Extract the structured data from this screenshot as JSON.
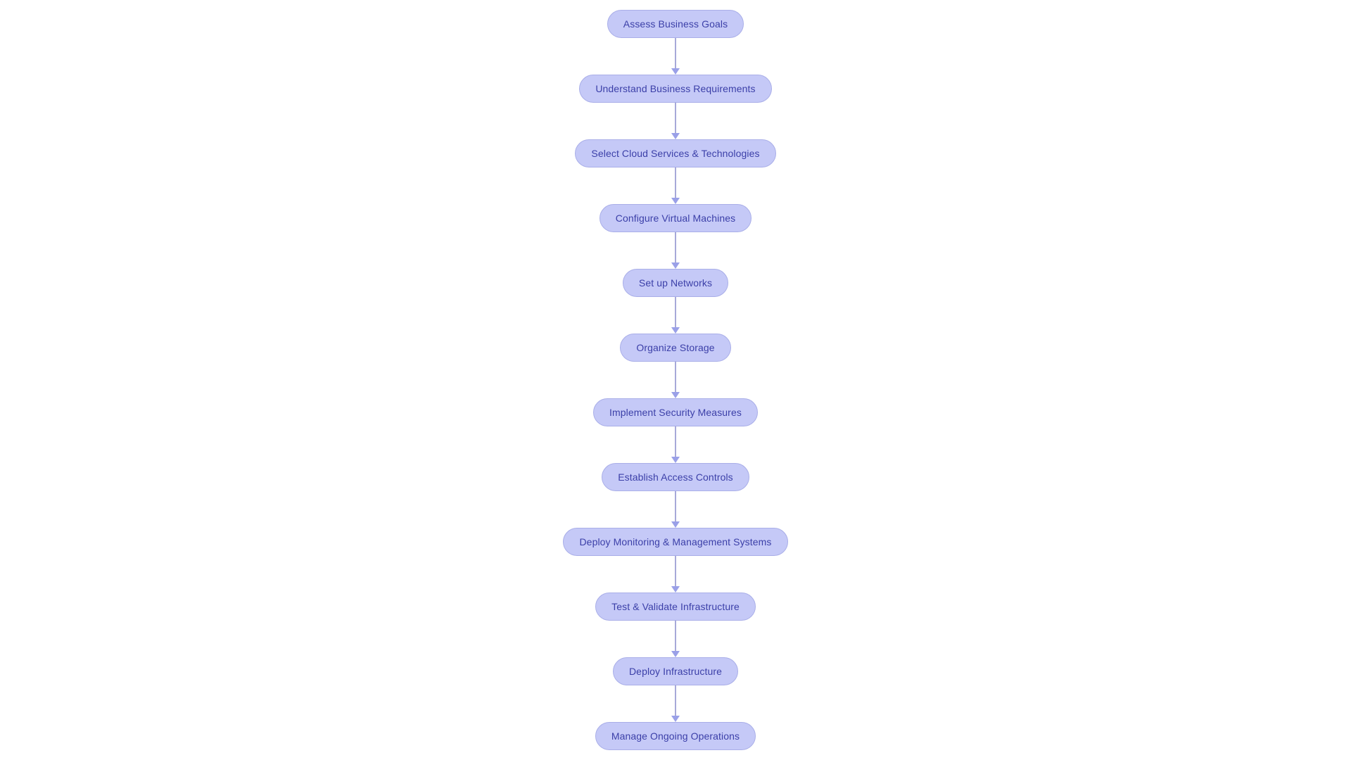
{
  "diagram": {
    "type": "flowchart",
    "orientation": "top-to-bottom",
    "background_color": "#ffffff",
    "node_fill_color": "#c5c9f7",
    "node_border_color": "#a9aee8",
    "node_text_color": "#3b3fa8",
    "connector_color": "#a7a9d9",
    "arrowhead_color": "#9aa0e8",
    "nodes": [
      {
        "id": "n1",
        "label": "Assess Business Goals"
      },
      {
        "id": "n2",
        "label": "Understand Business Requirements"
      },
      {
        "id": "n3",
        "label": "Select Cloud Services & Technologies"
      },
      {
        "id": "n4",
        "label": "Configure Virtual Machines"
      },
      {
        "id": "n5",
        "label": "Set up Networks"
      },
      {
        "id": "n6",
        "label": "Organize Storage"
      },
      {
        "id": "n7",
        "label": "Implement Security Measures"
      },
      {
        "id": "n8",
        "label": "Establish Access Controls"
      },
      {
        "id": "n9",
        "label": "Deploy Monitoring & Management Systems"
      },
      {
        "id": "n10",
        "label": "Test & Validate Infrastructure"
      },
      {
        "id": "n11",
        "label": "Deploy Infrastructure"
      },
      {
        "id": "n12",
        "label": "Manage Ongoing Operations"
      }
    ],
    "edges": [
      {
        "from": "n1",
        "to": "n2"
      },
      {
        "from": "n2",
        "to": "n3"
      },
      {
        "from": "n3",
        "to": "n4"
      },
      {
        "from": "n4",
        "to": "n5"
      },
      {
        "from": "n5",
        "to": "n6"
      },
      {
        "from": "n6",
        "to": "n7"
      },
      {
        "from": "n7",
        "to": "n8"
      },
      {
        "from": "n8",
        "to": "n9"
      },
      {
        "from": "n9",
        "to": "n10"
      },
      {
        "from": "n10",
        "to": "n11"
      },
      {
        "from": "n11",
        "to": "n12"
      }
    ]
  }
}
